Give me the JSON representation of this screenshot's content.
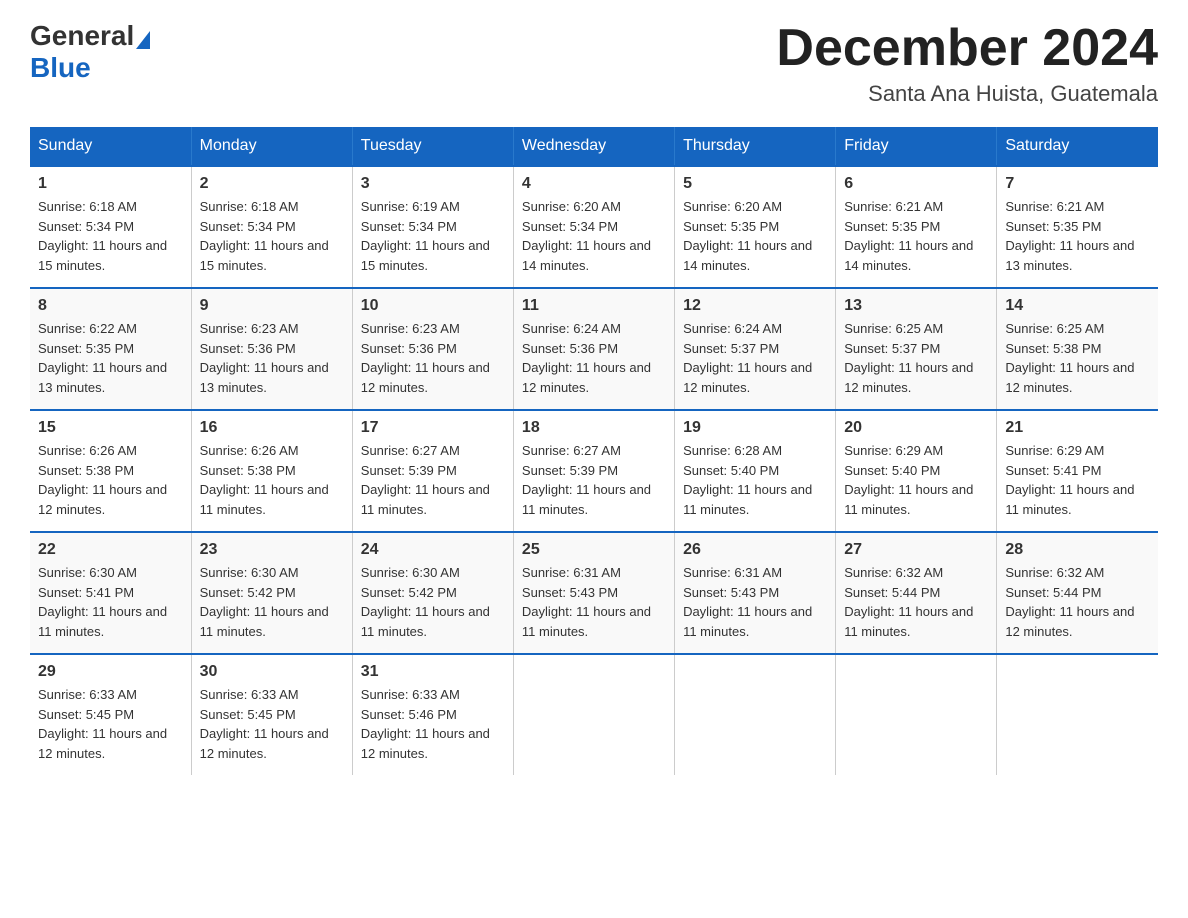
{
  "header": {
    "logo_general": "General",
    "logo_blue": "Blue",
    "month_title": "December 2024",
    "subtitle": "Santa Ana Huista, Guatemala"
  },
  "days_of_week": [
    "Sunday",
    "Monday",
    "Tuesday",
    "Wednesday",
    "Thursday",
    "Friday",
    "Saturday"
  ],
  "weeks": [
    [
      {
        "day": "1",
        "sunrise": "6:18 AM",
        "sunset": "5:34 PM",
        "daylight": "11 hours and 15 minutes."
      },
      {
        "day": "2",
        "sunrise": "6:18 AM",
        "sunset": "5:34 PM",
        "daylight": "11 hours and 15 minutes."
      },
      {
        "day": "3",
        "sunrise": "6:19 AM",
        "sunset": "5:34 PM",
        "daylight": "11 hours and 15 minutes."
      },
      {
        "day": "4",
        "sunrise": "6:20 AM",
        "sunset": "5:34 PM",
        "daylight": "11 hours and 14 minutes."
      },
      {
        "day": "5",
        "sunrise": "6:20 AM",
        "sunset": "5:35 PM",
        "daylight": "11 hours and 14 minutes."
      },
      {
        "day": "6",
        "sunrise": "6:21 AM",
        "sunset": "5:35 PM",
        "daylight": "11 hours and 14 minutes."
      },
      {
        "day": "7",
        "sunrise": "6:21 AM",
        "sunset": "5:35 PM",
        "daylight": "11 hours and 13 minutes."
      }
    ],
    [
      {
        "day": "8",
        "sunrise": "6:22 AM",
        "sunset": "5:35 PM",
        "daylight": "11 hours and 13 minutes."
      },
      {
        "day": "9",
        "sunrise": "6:23 AM",
        "sunset": "5:36 PM",
        "daylight": "11 hours and 13 minutes."
      },
      {
        "day": "10",
        "sunrise": "6:23 AM",
        "sunset": "5:36 PM",
        "daylight": "11 hours and 12 minutes."
      },
      {
        "day": "11",
        "sunrise": "6:24 AM",
        "sunset": "5:36 PM",
        "daylight": "11 hours and 12 minutes."
      },
      {
        "day": "12",
        "sunrise": "6:24 AM",
        "sunset": "5:37 PM",
        "daylight": "11 hours and 12 minutes."
      },
      {
        "day": "13",
        "sunrise": "6:25 AM",
        "sunset": "5:37 PM",
        "daylight": "11 hours and 12 minutes."
      },
      {
        "day": "14",
        "sunrise": "6:25 AM",
        "sunset": "5:38 PM",
        "daylight": "11 hours and 12 minutes."
      }
    ],
    [
      {
        "day": "15",
        "sunrise": "6:26 AM",
        "sunset": "5:38 PM",
        "daylight": "11 hours and 12 minutes."
      },
      {
        "day": "16",
        "sunrise": "6:26 AM",
        "sunset": "5:38 PM",
        "daylight": "11 hours and 11 minutes."
      },
      {
        "day": "17",
        "sunrise": "6:27 AM",
        "sunset": "5:39 PM",
        "daylight": "11 hours and 11 minutes."
      },
      {
        "day": "18",
        "sunrise": "6:27 AM",
        "sunset": "5:39 PM",
        "daylight": "11 hours and 11 minutes."
      },
      {
        "day": "19",
        "sunrise": "6:28 AM",
        "sunset": "5:40 PM",
        "daylight": "11 hours and 11 minutes."
      },
      {
        "day": "20",
        "sunrise": "6:29 AM",
        "sunset": "5:40 PM",
        "daylight": "11 hours and 11 minutes."
      },
      {
        "day": "21",
        "sunrise": "6:29 AM",
        "sunset": "5:41 PM",
        "daylight": "11 hours and 11 minutes."
      }
    ],
    [
      {
        "day": "22",
        "sunrise": "6:30 AM",
        "sunset": "5:41 PM",
        "daylight": "11 hours and 11 minutes."
      },
      {
        "day": "23",
        "sunrise": "6:30 AM",
        "sunset": "5:42 PM",
        "daylight": "11 hours and 11 minutes."
      },
      {
        "day": "24",
        "sunrise": "6:30 AM",
        "sunset": "5:42 PM",
        "daylight": "11 hours and 11 minutes."
      },
      {
        "day": "25",
        "sunrise": "6:31 AM",
        "sunset": "5:43 PM",
        "daylight": "11 hours and 11 minutes."
      },
      {
        "day": "26",
        "sunrise": "6:31 AM",
        "sunset": "5:43 PM",
        "daylight": "11 hours and 11 minutes."
      },
      {
        "day": "27",
        "sunrise": "6:32 AM",
        "sunset": "5:44 PM",
        "daylight": "11 hours and 11 minutes."
      },
      {
        "day": "28",
        "sunrise": "6:32 AM",
        "sunset": "5:44 PM",
        "daylight": "11 hours and 12 minutes."
      }
    ],
    [
      {
        "day": "29",
        "sunrise": "6:33 AM",
        "sunset": "5:45 PM",
        "daylight": "11 hours and 12 minutes."
      },
      {
        "day": "30",
        "sunrise": "6:33 AM",
        "sunset": "5:45 PM",
        "daylight": "11 hours and 12 minutes."
      },
      {
        "day": "31",
        "sunrise": "6:33 AM",
        "sunset": "5:46 PM",
        "daylight": "11 hours and 12 minutes."
      },
      null,
      null,
      null,
      null
    ]
  ]
}
